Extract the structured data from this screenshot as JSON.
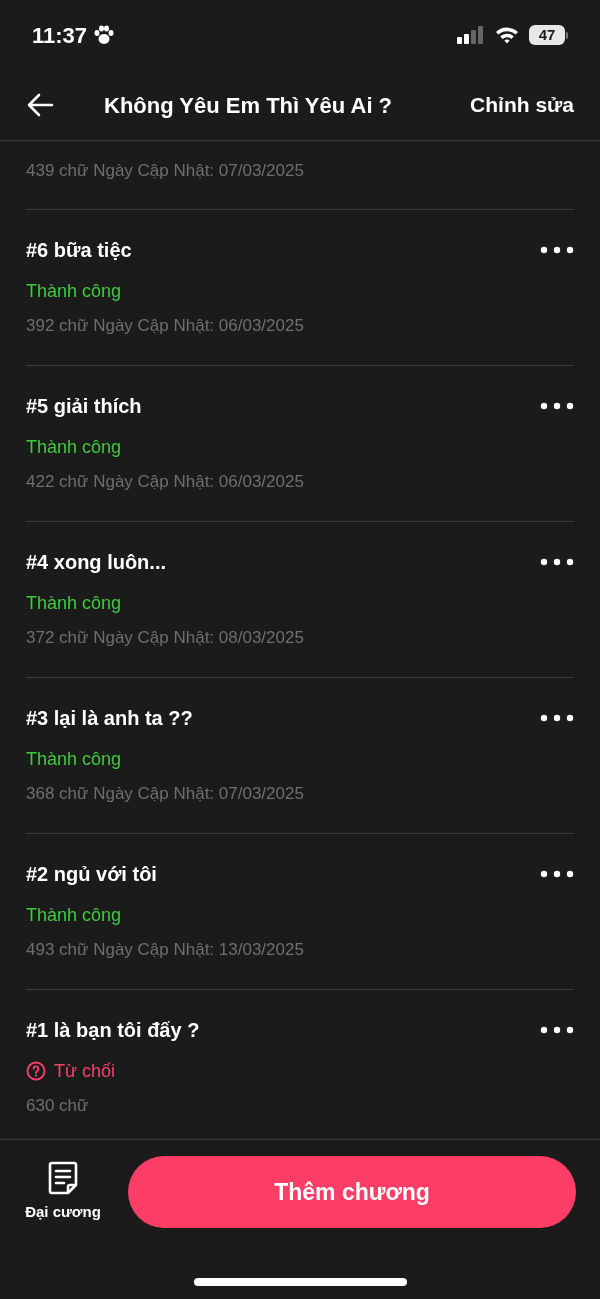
{
  "status_bar": {
    "time": "11:37",
    "battery": "47"
  },
  "header": {
    "title": "Không Yêu Em Thì Yêu Ai ?",
    "action": "Chỉnh sửa"
  },
  "chapters": [
    {
      "kind": "partial",
      "meta": "439 chữ Ngày Cập Nhật: 07/03/2025"
    },
    {
      "kind": "full",
      "title": "#6 bữa tiệc",
      "status": {
        "text": "Thành công",
        "kind": "success"
      },
      "meta": "392 chữ Ngày Cập Nhật: 06/03/2025"
    },
    {
      "kind": "full",
      "title": "#5 giải thích",
      "status": {
        "text": "Thành công",
        "kind": "success"
      },
      "meta": "422 chữ Ngày Cập Nhật: 06/03/2025"
    },
    {
      "kind": "full",
      "title": "#4 xong luôn...",
      "status": {
        "text": "Thành công",
        "kind": "success"
      },
      "meta": "372 chữ Ngày Cập Nhật: 08/03/2025"
    },
    {
      "kind": "full",
      "title": "#3 lại là anh ta ??",
      "status": {
        "text": "Thành công",
        "kind": "success"
      },
      "meta": "368 chữ Ngày Cập Nhật: 07/03/2025"
    },
    {
      "kind": "full",
      "title": "#2 ngủ với tôi",
      "status": {
        "text": "Thành công",
        "kind": "success"
      },
      "meta": "493 chữ Ngày Cập Nhật: 13/03/2025"
    },
    {
      "kind": "full",
      "title": "#1 là bạn tôi đấy ?",
      "status": {
        "text": "Từ chối",
        "kind": "rejected"
      },
      "meta": "630 chữ"
    }
  ],
  "bottom_bar": {
    "outline_label": "Đại cương",
    "add_button": "Thêm chương"
  }
}
